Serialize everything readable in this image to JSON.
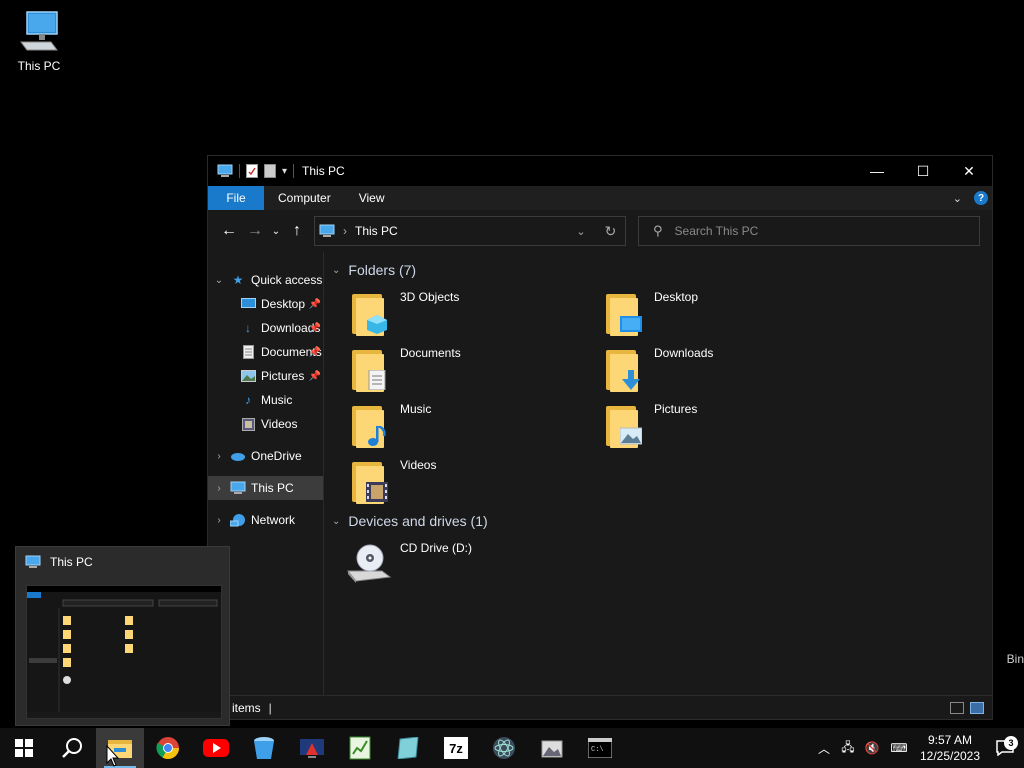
{
  "desktop": {
    "icons": [
      {
        "label": "This PC"
      },
      {
        "label": "Bin"
      }
    ]
  },
  "window": {
    "title": "This PC",
    "controls": {
      "minimize": "—",
      "maximize": "☐",
      "close": "✕"
    },
    "ribbon": {
      "tabs": [
        "File",
        "Computer",
        "View"
      ],
      "help": "?"
    },
    "address": {
      "crumb": "This PC"
    },
    "search": {
      "placeholder": "Search This PC"
    },
    "nav": {
      "quick_access": "Quick access",
      "items": [
        {
          "label": "Desktop",
          "pinned": true
        },
        {
          "label": "Downloads",
          "pinned": true
        },
        {
          "label": "Documents",
          "pinned": true
        },
        {
          "label": "Pictures",
          "pinned": true
        },
        {
          "label": "Music",
          "pinned": false
        },
        {
          "label": "Videos",
          "pinned": false
        }
      ],
      "onedrive": "OneDrive",
      "thispc": "This PC",
      "network": "Network"
    },
    "folders_header": "Folders (7)",
    "folders": [
      {
        "label": "3D Objects",
        "icon": "cube-icon"
      },
      {
        "label": "Desktop",
        "icon": "monitor-icon"
      },
      {
        "label": "Documents",
        "icon": "document-icon"
      },
      {
        "label": "Downloads",
        "icon": "download-arrow-icon"
      },
      {
        "label": "Music",
        "icon": "music-note-icon"
      },
      {
        "label": "Pictures",
        "icon": "landscape-icon"
      },
      {
        "label": "Videos",
        "icon": "film-icon"
      }
    ],
    "devices_header": "Devices and drives (1)",
    "devices": [
      {
        "label": "CD Drive (D:)",
        "icon": "cd-drive-icon"
      }
    ],
    "status": {
      "items": "items"
    }
  },
  "preview": {
    "title": "This PC"
  },
  "taskbar": {
    "apps": [
      "start-icon",
      "search-icon",
      "file-explorer-icon",
      "chrome-icon",
      "youtube-icon",
      "bucket-icon",
      "media-icon",
      "spreadsheet-icon",
      "book-icon",
      "7zip-icon",
      "atom-icon",
      "photos-icon",
      "terminal-icon"
    ],
    "clock": {
      "time": "9:57 AM",
      "date": "12/25/2023"
    },
    "notifications": "3"
  }
}
